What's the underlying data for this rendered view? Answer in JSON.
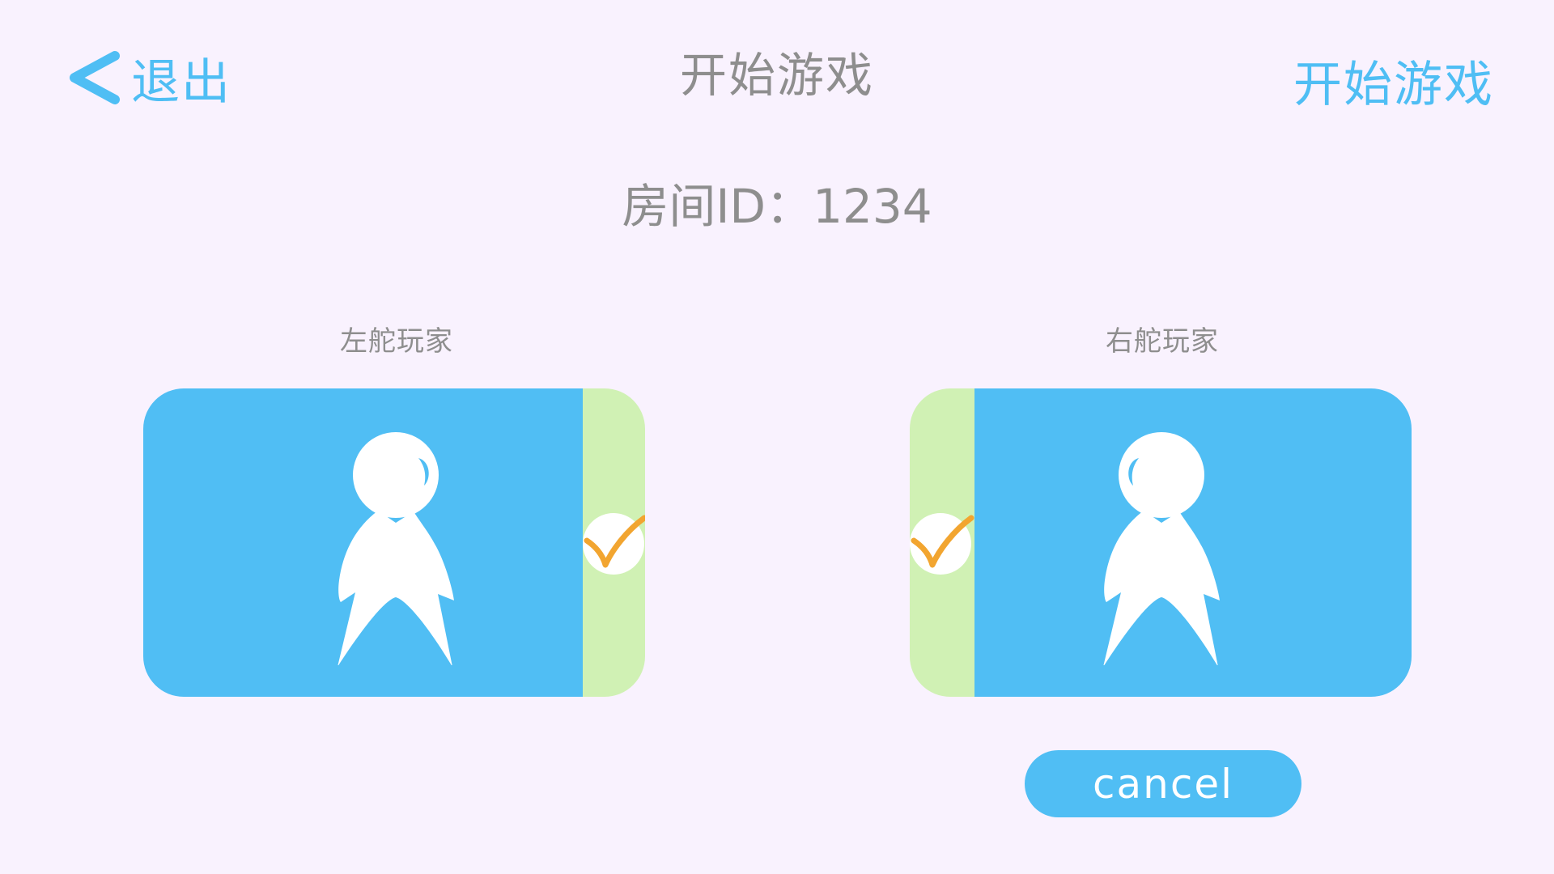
{
  "header": {
    "back_label": "退出",
    "title": "开始游戏",
    "start_label": "开始游戏"
  },
  "room": {
    "id_text": "房间ID：1234"
  },
  "players": {
    "left": {
      "label": "左舵玩家",
      "ready": true
    },
    "right": {
      "label": "右舵玩家",
      "ready": true
    }
  },
  "actions": {
    "cancel_label": "cancel"
  },
  "colors": {
    "background": "#F9F2FE",
    "accent": "#50BEF4",
    "ready_strip": "#D0F1B4",
    "check": "#F2A530",
    "text_gray": "#8E8E8E"
  }
}
